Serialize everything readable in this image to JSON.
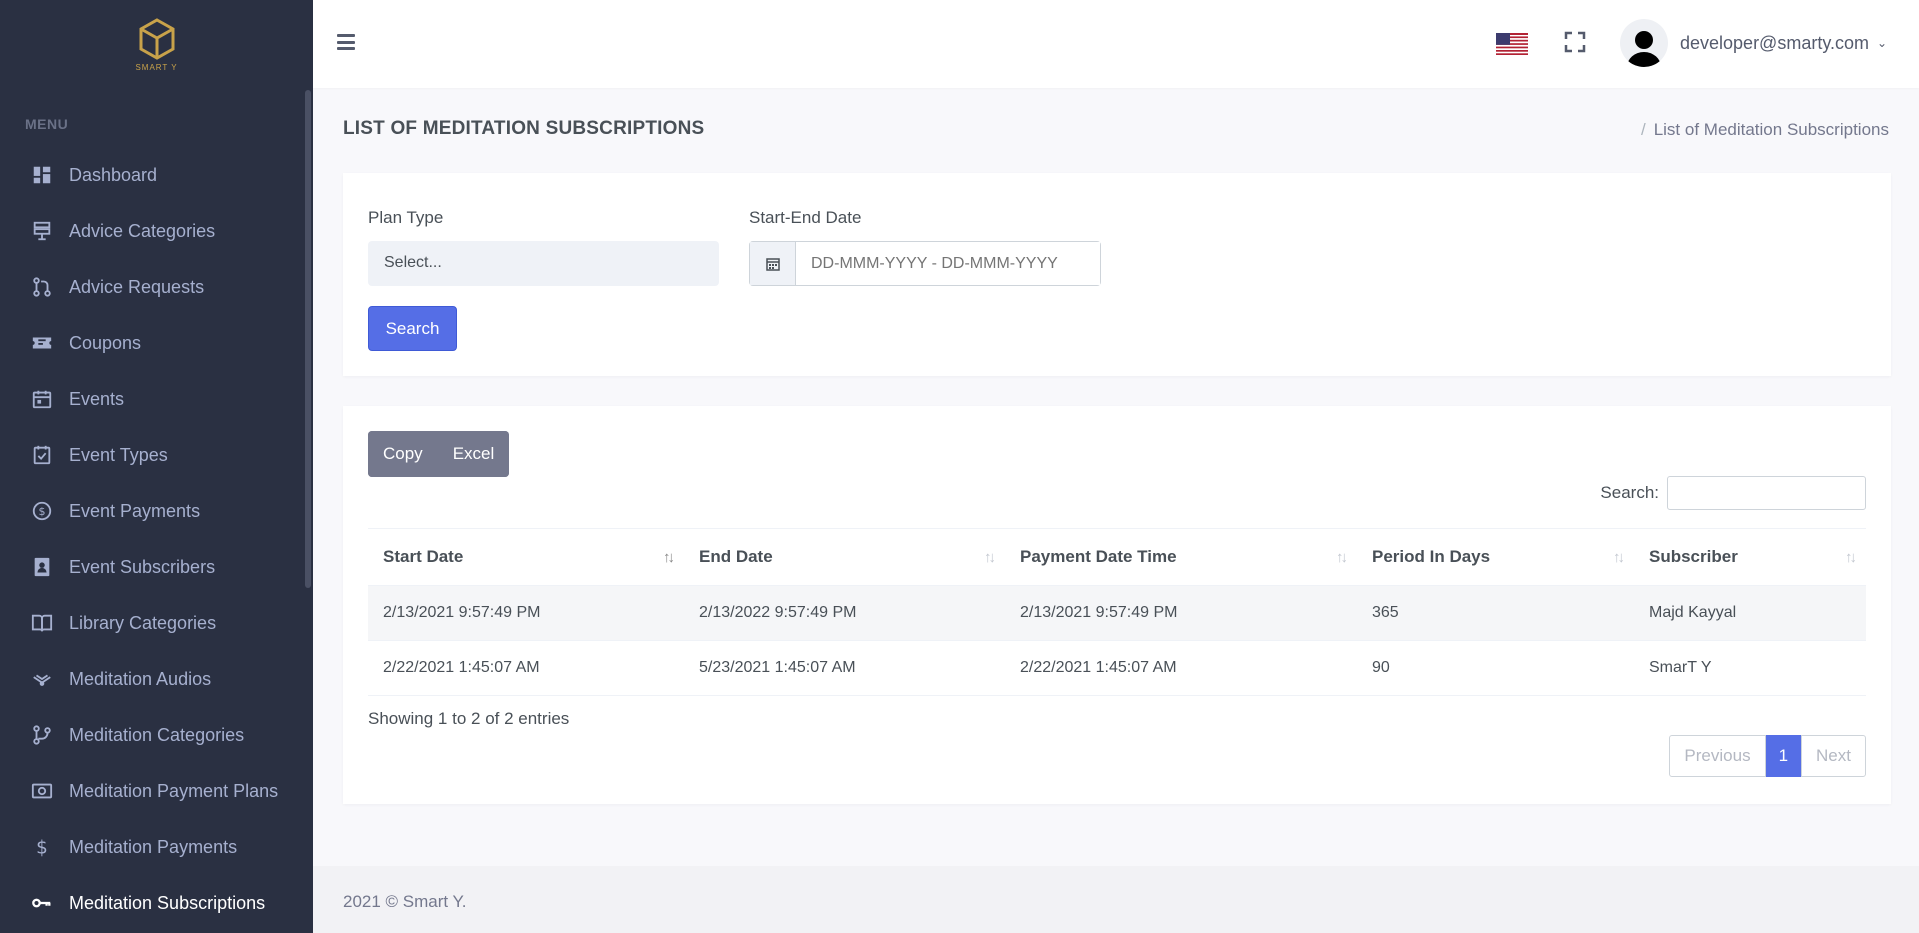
{
  "brand": {
    "logo_text": "SMART Y",
    "accent": "#c8a24a"
  },
  "sidebar": {
    "menu_title": "MENU",
    "items": [
      {
        "label": "Dashboard",
        "icon": "dashboard-icon"
      },
      {
        "label": "Advice Categories",
        "icon": "categories-icon"
      },
      {
        "label": "Advice Requests",
        "icon": "git-pull-request-icon"
      },
      {
        "label": "Coupons",
        "icon": "coupon-icon"
      },
      {
        "label": "Events",
        "icon": "calendar-icon"
      },
      {
        "label": "Event Types",
        "icon": "calendar-check-icon"
      },
      {
        "label": "Event Payments",
        "icon": "dollar-circle-icon"
      },
      {
        "label": "Event Subscribers",
        "icon": "id-card-icon"
      },
      {
        "label": "Library Categories",
        "icon": "book-icon"
      },
      {
        "label": "Meditation Audios",
        "icon": "wifi-icon"
      },
      {
        "label": "Meditation Categories",
        "icon": "git-branch-icon"
      },
      {
        "label": "Meditation Payment Plans",
        "icon": "money-icon"
      },
      {
        "label": "Meditation Payments",
        "icon": "dollar-icon"
      },
      {
        "label": "Meditation Subscriptions",
        "icon": "key-icon",
        "active": true
      }
    ]
  },
  "topbar": {
    "user_email": "developer@smarty.com",
    "language": "us-flag-icon"
  },
  "page": {
    "title": "LIST OF MEDITATION SUBSCRIPTIONS",
    "breadcrumb": "List of Meditation Subscriptions"
  },
  "filters": {
    "plan_type_label": "Plan Type",
    "plan_type_value": "Select...",
    "date_label": "Start-End Date",
    "date_placeholder": "DD-MMM-YYYY - DD-MMM-YYYY",
    "search_button": "Search"
  },
  "table": {
    "copy_button": "Copy",
    "excel_button": "Excel",
    "search_label": "Search:",
    "columns": [
      "Start Date",
      "End Date",
      "Payment Date Time",
      "Period In Days",
      "Subscriber"
    ],
    "rows": [
      [
        "2/13/2021 9:57:49 PM",
        "2/13/2022 9:57:49 PM",
        "2/13/2021 9:57:49 PM",
        "365",
        "Majd Kayyal"
      ],
      [
        "2/22/2021 1:45:07 AM",
        "5/23/2021 1:45:07 AM",
        "2/22/2021 1:45:07 AM",
        "90",
        "SmarT Y"
      ]
    ],
    "info": "Showing 1 to 2 of 2 entries",
    "pagination": {
      "previous": "Previous",
      "current": "1",
      "next": "Next"
    }
  },
  "footer": {
    "text": "2021 © Smart Y."
  },
  "colors": {
    "sidebar_bg": "#2a3042",
    "primary": "#556ee6",
    "secondary": "#74788d"
  }
}
